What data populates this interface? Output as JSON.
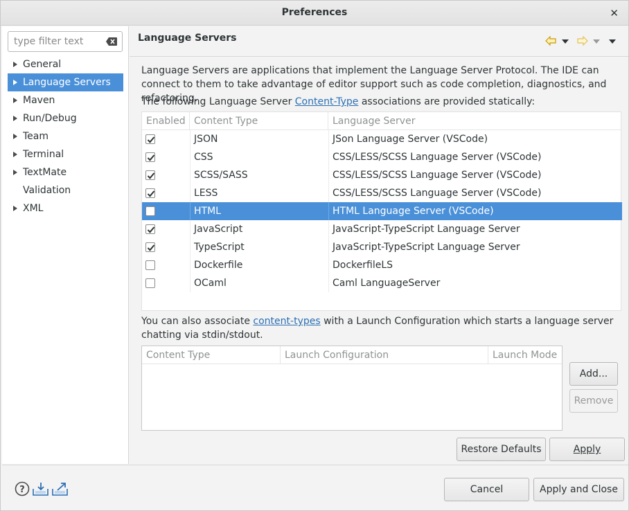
{
  "window": {
    "title": "Preferences",
    "close_glyph": "✕"
  },
  "filter": {
    "placeholder": "type filter text",
    "value": "",
    "clear_icon": "clear-icon"
  },
  "tree": {
    "items": [
      {
        "label": "General",
        "has_children": true,
        "selected": false
      },
      {
        "label": "Language Servers",
        "has_children": true,
        "selected": true
      },
      {
        "label": "Maven",
        "has_children": true,
        "selected": false
      },
      {
        "label": "Run/Debug",
        "has_children": true,
        "selected": false
      },
      {
        "label": "Team",
        "has_children": true,
        "selected": false
      },
      {
        "label": "Terminal",
        "has_children": true,
        "selected": false
      },
      {
        "label": "TextMate",
        "has_children": true,
        "selected": false
      },
      {
        "label": "Validation",
        "has_children": false,
        "selected": false
      },
      {
        "label": "XML",
        "has_children": true,
        "selected": false
      }
    ]
  },
  "page": {
    "title": "Language Servers",
    "description": "Language Servers are applications that implement the Language Server Protocol. The IDE can connect to them to take advantage of editor support such as code completion, diagnostics, and refactoring.",
    "assoc_prefix": "The following Language Server ",
    "assoc_link": "Content-Type",
    "assoc_suffix": " associations are provided statically:",
    "static_table": {
      "headers": [
        "Enabled",
        "Content Type",
        "Language Server"
      ],
      "rows": [
        {
          "enabled": true,
          "content_type": "JSON",
          "server": "JSon Language Server (VSCode)",
          "selected": false
        },
        {
          "enabled": true,
          "content_type": "CSS",
          "server": "CSS/LESS/SCSS Language Server (VSCode)",
          "selected": false
        },
        {
          "enabled": true,
          "content_type": "SCSS/SASS",
          "server": "CSS/LESS/SCSS Language Server (VSCode)",
          "selected": false
        },
        {
          "enabled": true,
          "content_type": "LESS",
          "server": "CSS/LESS/SCSS Language Server (VSCode)",
          "selected": false
        },
        {
          "enabled": false,
          "content_type": "HTML",
          "server": "HTML Language Server (VSCode)",
          "selected": true
        },
        {
          "enabled": true,
          "content_type": "JavaScript",
          "server": "JavaScript-TypeScript Language Server",
          "selected": false
        },
        {
          "enabled": true,
          "content_type": "TypeScript",
          "server": "JavaScript-TypeScript Language Server",
          "selected": false
        },
        {
          "enabled": false,
          "content_type": "Dockerfile",
          "server": "DockerfileLS",
          "selected": false
        },
        {
          "enabled": false,
          "content_type": "OCaml",
          "server": "Caml LanguageServer",
          "selected": false
        }
      ]
    },
    "launch_prefix": "You can also associate ",
    "launch_link": "content-types",
    "launch_suffix": " with a Launch Configuration which starts a language server chatting via stdin/stdout.",
    "launch_table": {
      "headers": [
        "Content Type",
        "Launch Configuration",
        "Launch Mode"
      ],
      "rows": []
    },
    "add_label": "Add...",
    "remove_label": "Remove",
    "restore_label": "Restore Defaults",
    "apply_label": "Apply"
  },
  "footer": {
    "cancel_label": "Cancel",
    "apply_close_label": "Apply and Close",
    "icons": [
      "help-icon",
      "import-icon",
      "export-icon"
    ]
  },
  "colors": {
    "selection": "#4a90d9",
    "link": "#2a6fb4",
    "nav_arrow": "#e0b030"
  }
}
